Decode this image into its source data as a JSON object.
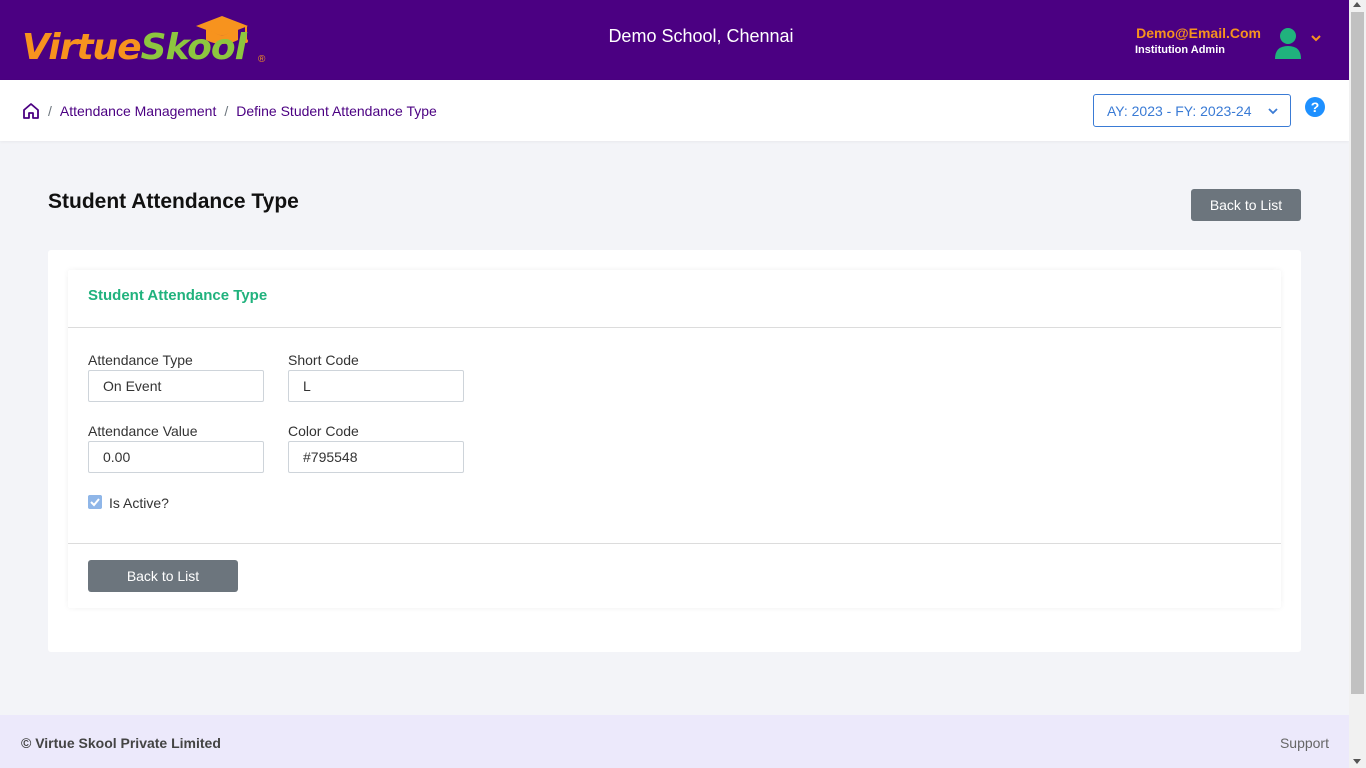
{
  "header": {
    "logo_virtue": "Virtue",
    "logo_skool": "Skool",
    "logo_reg": "®",
    "school_name": "Demo School, Chennai",
    "user_email": "Demo@Email.Com",
    "user_role": "Institution Admin"
  },
  "breadcrumb": {
    "separator": "/",
    "items": [
      "Attendance Management",
      "Define Student Attendance Type"
    ],
    "academic_year": "AY: 2023 - FY: 2023-24",
    "help": "?"
  },
  "page": {
    "title": "Student Attendance Type",
    "back_label": "Back to List"
  },
  "form": {
    "card_title": "Student Attendance Type",
    "attendance_type_label": "Attendance Type",
    "attendance_type_value": "On Event",
    "short_code_label": "Short Code",
    "short_code_value": "L",
    "attendance_value_label": "Attendance Value",
    "attendance_value_value": "0.00",
    "color_code_label": "Color Code",
    "color_code_value": "#795548",
    "is_active_label": "Is Active?",
    "is_active": true,
    "back_label": "Back to List"
  },
  "footer": {
    "copyright": "© Virtue Skool Private Limited",
    "support": "Support"
  },
  "colors": {
    "header_bg": "#4b0082",
    "accent_orange": "#f7931e",
    "accent_green": "#8dc63f",
    "card_title": "#20b27d",
    "button_gray": "#6c757d",
    "link_blue": "#3a7bd5"
  }
}
